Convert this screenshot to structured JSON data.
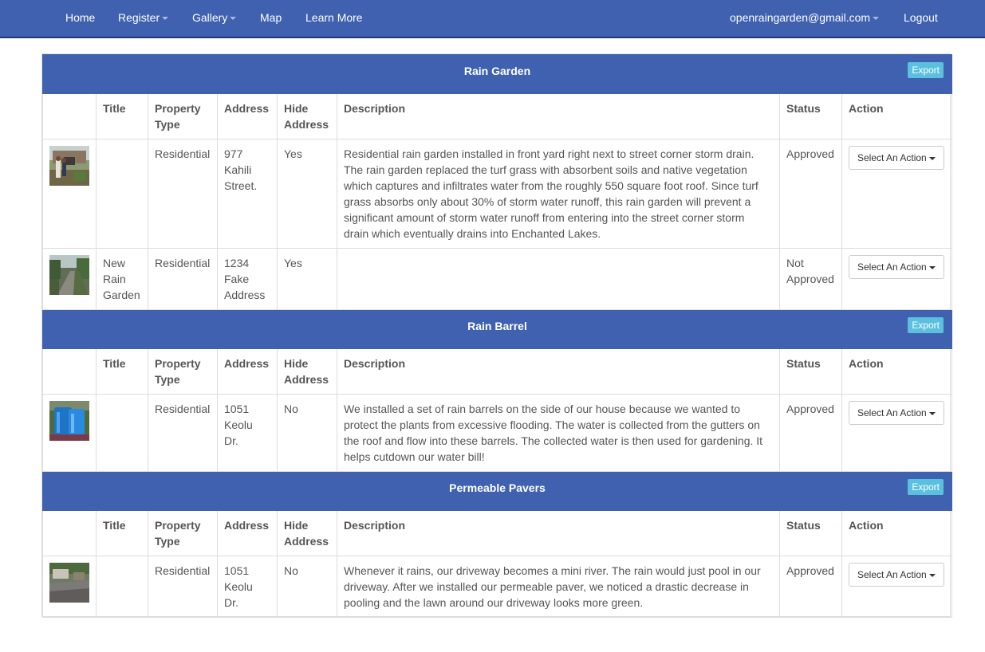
{
  "nav": {
    "home": "Home",
    "register": "Register",
    "gallery": "Gallery",
    "map": "Map",
    "learn_more": "Learn More",
    "user_email": "openraingarden@gmail.com",
    "logout": "Logout"
  },
  "colors": {
    "brand": "#3f61af",
    "export": "#5bc0de",
    "border": "#dddddd"
  },
  "headers": {
    "title": "Title",
    "property_type_1": "Property",
    "property_type_2": "Type",
    "address": "Address",
    "hide_address_1": "Hide",
    "hide_address_2": "Address",
    "description": "Description",
    "status": "Status",
    "action": "Action"
  },
  "export_label": "Export",
  "action_label": "Select An Action",
  "sections": [
    {
      "name": "Rain Garden",
      "rows": [
        {
          "thumb": "photo-people-in-front-yard",
          "title": "",
          "property_type": "Residential",
          "address_1": "977",
          "address_2": "Kahili",
          "address_3": "Street.",
          "hide_address": "Yes",
          "description_1": "Residential rain garden installed in front yard right next to street corner storm drain.",
          "description_2": "The rain garden replaced the turf grass with absorbent soils and native vegetation",
          "description_3": "which captures and infiltrates water from the roughly 550 square foot roof. Since turf",
          "description_4": "grass absorbs only about 30% of storm water runoff, this rain garden will prevent a",
          "description_5": "significant amount of storm water runoff from entering into the street corner storm",
          "description_6": "drain which eventually drains into Enchanted Lakes.",
          "status_1": "Approved",
          "status_2": ""
        },
        {
          "thumb": "photo-garden-path",
          "title_1": "New",
          "title_2": "Rain",
          "title_3": "Garden",
          "property_type": "Residential",
          "address_1": "1234",
          "address_2": "Fake",
          "address_3": "Address",
          "hide_address": "Yes",
          "status_1": "Not",
          "status_2": "Approved"
        }
      ]
    },
    {
      "name": "Rain Barrel",
      "rows": [
        {
          "thumb": "photo-blue-rain-barrels",
          "property_type": "Residential",
          "address_1": "1051",
          "address_2": "Keolu",
          "address_3": "Dr.",
          "hide_address": "No",
          "description_1": "We installed a set of rain barrels on the side of our house because we wanted to",
          "description_2": "protect the plants from excessive flooding. The water is collected from the gutters on",
          "description_3": "the roof and flow into these barrels. The collected water is then used for gardening. It",
          "description_4": "helps cutdown our water bill!",
          "status_1": "Approved"
        }
      ]
    },
    {
      "name": "Permeable Pavers",
      "rows": [
        {
          "thumb": "photo-paver-driveway",
          "property_type": "Residential",
          "address_1": "1051",
          "address_2": "Keolu",
          "address_3": "Dr.",
          "hide_address": "No",
          "description_1": "Whenever it rains, our driveway becomes a mini river. The rain would just pool in our",
          "description_2": "driveway. After we installed our permeable paver, we noticed a drastic decrease in",
          "description_3": "pooling and the lawn around our driveway looks more green.",
          "status_1": "Approved"
        }
      ]
    }
  ]
}
